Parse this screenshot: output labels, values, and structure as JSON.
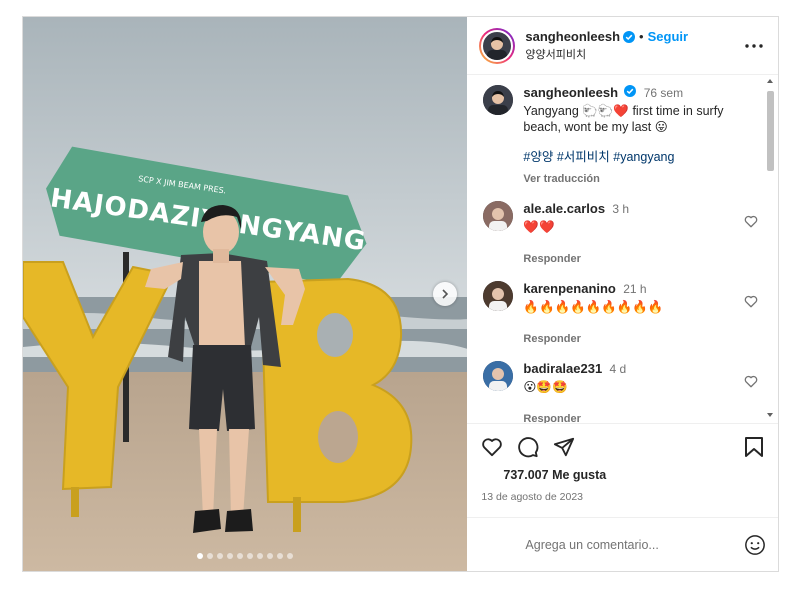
{
  "post": {
    "username": "sangheonleesh",
    "verified": true,
    "follow_label": "Seguir",
    "separator": "•",
    "location": "양양서피비치",
    "more_icon": "more-horizontal-icon"
  },
  "media": {
    "sign_text": "HAJODAZIYANGYANG",
    "sign_small_text": "SCP X JIM BEAM PRES.",
    "letters": [
      "Y",
      "B"
    ],
    "carousel_count": 10,
    "carousel_active_index": 0,
    "next_icon": "chevron-right-icon",
    "colors": {
      "sign": "#5aa587",
      "letters": "#e6b827",
      "sand": "#c9b49b",
      "sky": "#c7d0d5"
    }
  },
  "caption": {
    "username": "sangheonleesh",
    "time": "76 sem",
    "text_before": "Yangyang",
    "emojis": "🐑🐑❤️",
    "text_after": "first time in surfy beach, wont be my last",
    "emoji_end": "😛",
    "hashtags": "#양양 #서피비치 #yangyang",
    "translate_label": "Ver traducción"
  },
  "comments": [
    {
      "username": "ale.ale.carlos",
      "time": "3 h",
      "text": "❤️❤️",
      "reply_label": "Responder",
      "like_icon": "heart-outline-icon",
      "avatar_color": "#8a6b63"
    },
    {
      "username": "karenpenanino",
      "time": "21 h",
      "text": "🔥🔥🔥🔥🔥🔥🔥🔥🔥",
      "reply_label": "Responder",
      "like_icon": "heart-outline-icon",
      "avatar_color": "#4d3b2f"
    },
    {
      "username": "badiralae231",
      "time": "4 d",
      "text": "😮🤩🤩",
      "reply_label": "Responder",
      "like_icon": "heart-outline-icon",
      "avatar_color": "#3a6ea5"
    }
  ],
  "actions": {
    "like_icon": "heart-outline-icon",
    "comment_icon": "comment-bubble-icon",
    "share_icon": "send-paper-plane-icon",
    "save_icon": "bookmark-icon",
    "likes": "737.007 Me gusta",
    "date": "13 de agosto de 2023"
  },
  "add_comment": {
    "placeholder": "Agrega un comentario...",
    "emoji_icon": "smiley-face-icon"
  }
}
